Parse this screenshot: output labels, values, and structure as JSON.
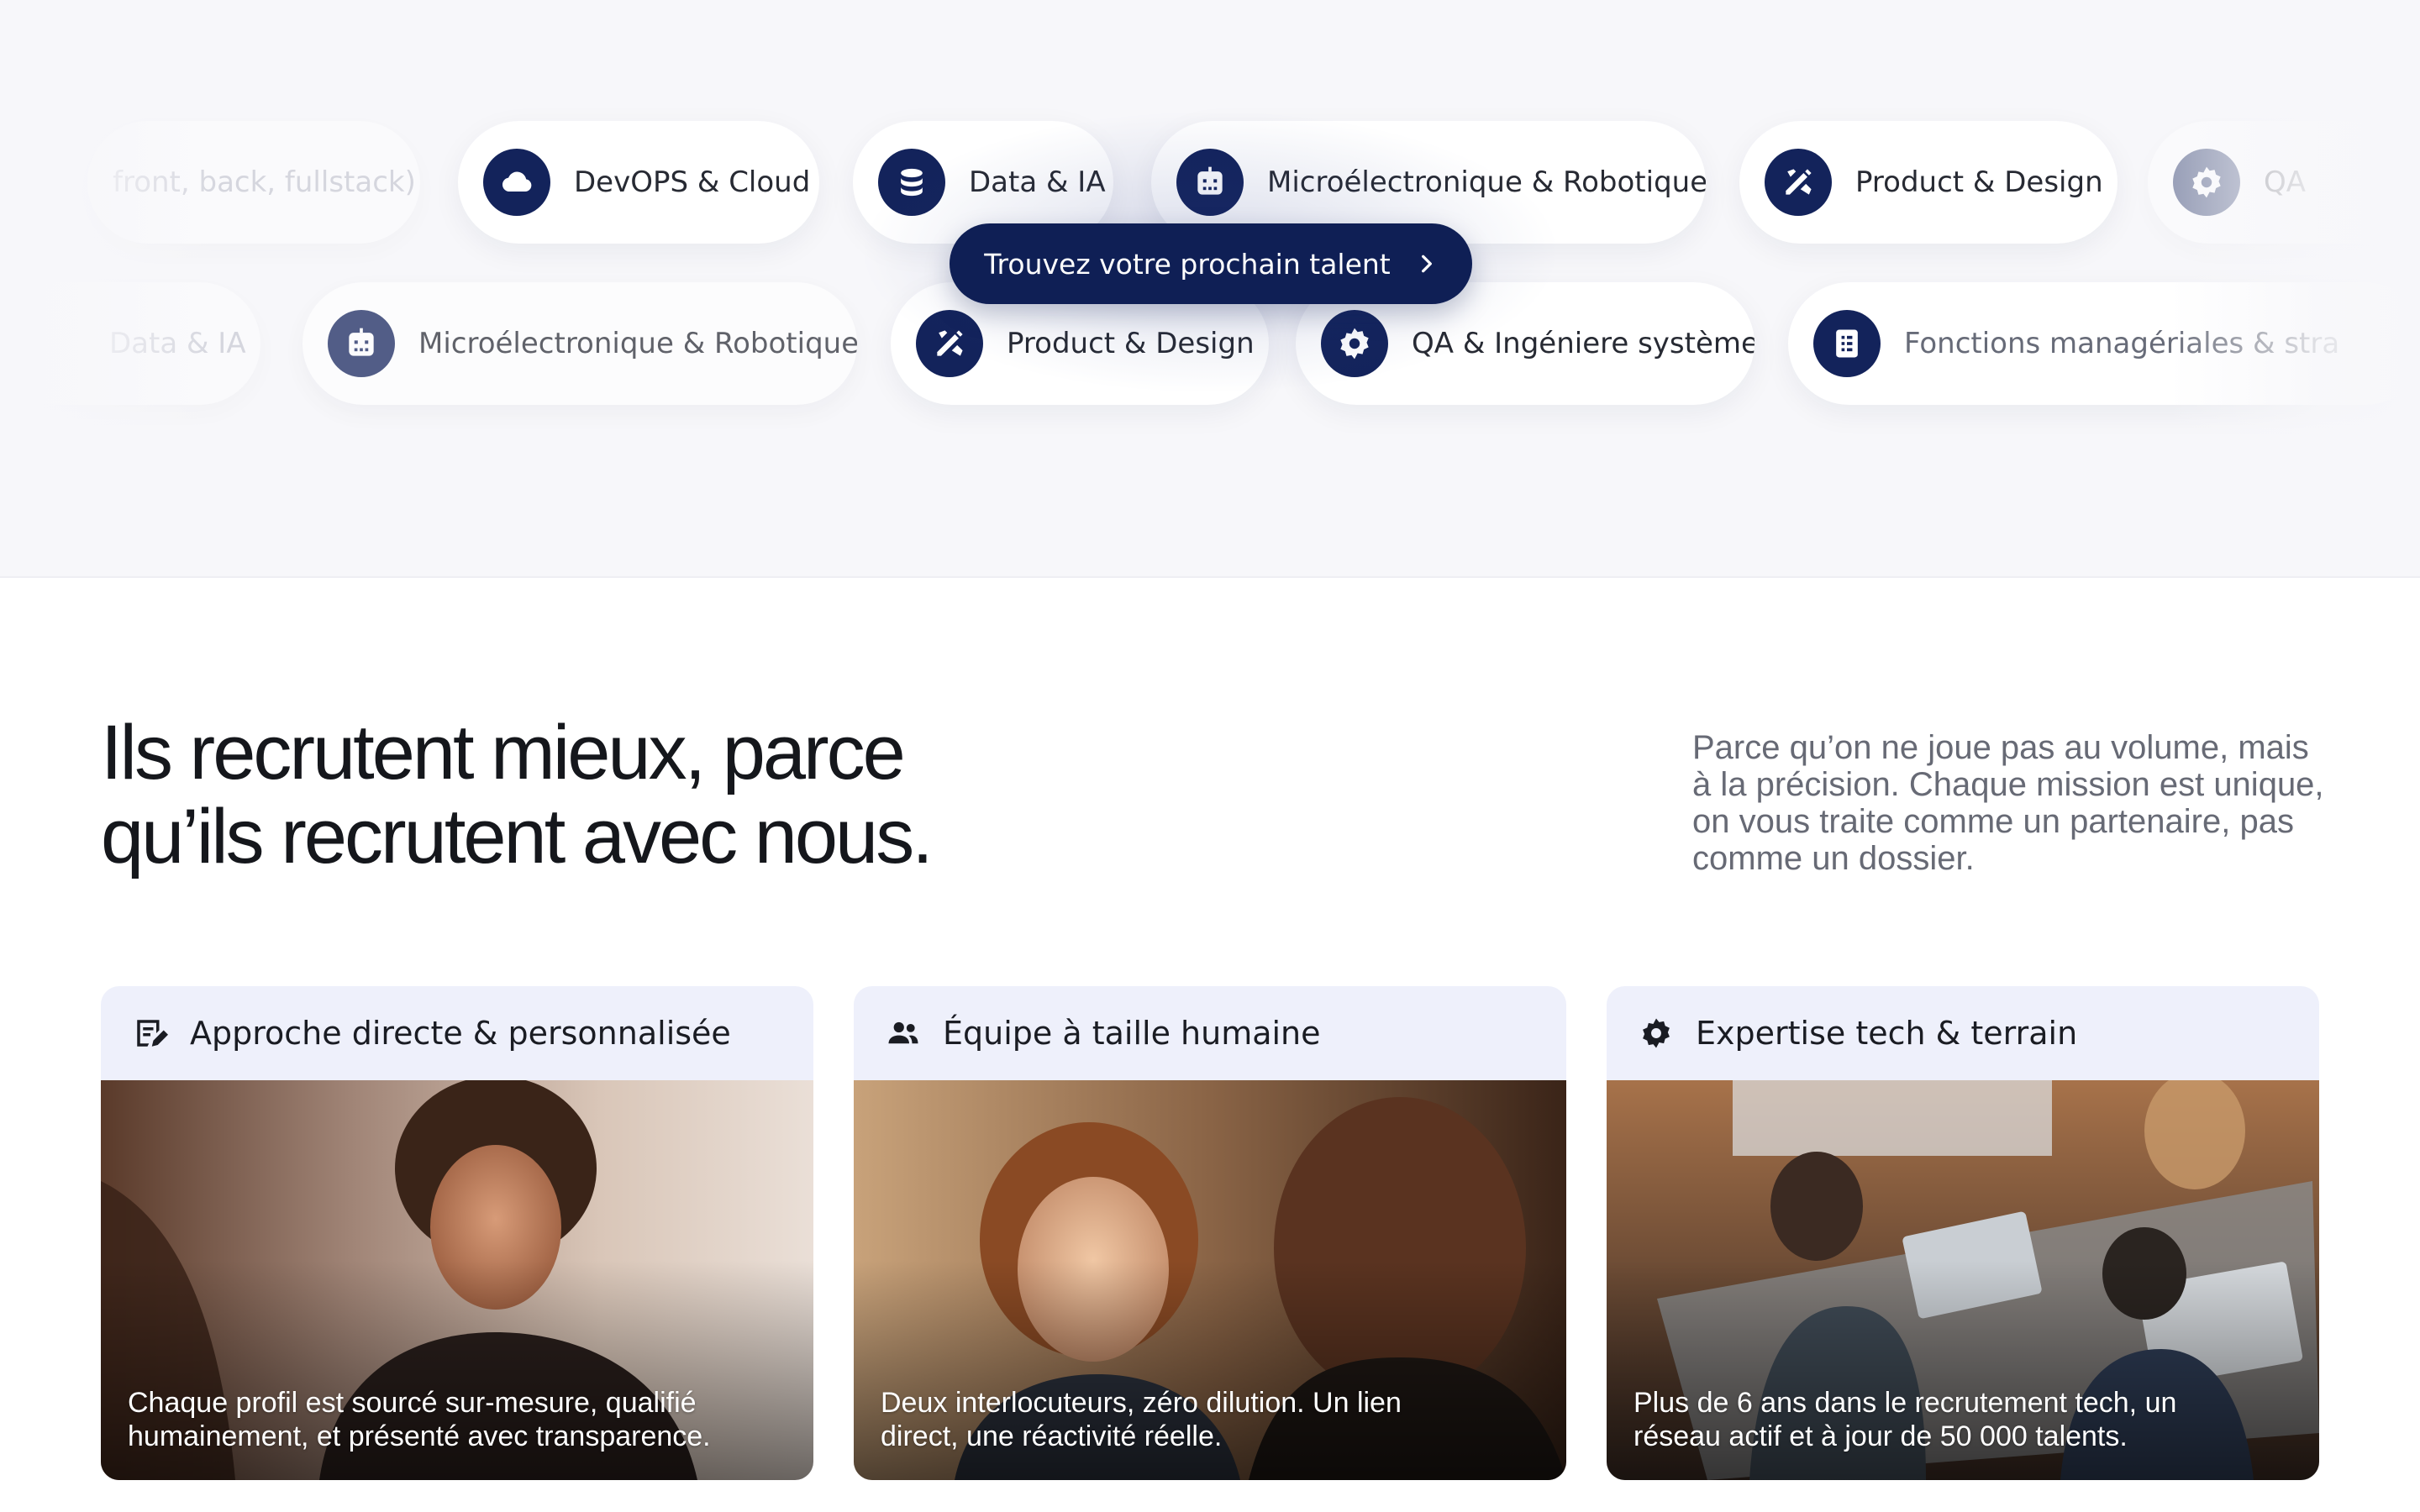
{
  "marquee": {
    "row1": [
      {
        "label": "front, back, fullstack)",
        "icon": "none"
      },
      {
        "label": "DevOPS & Cloud",
        "icon": "cloud-icon"
      },
      {
        "label": "Data & IA",
        "icon": "database-icon"
      },
      {
        "label": "Microélectronique & Robotique",
        "icon": "robot-icon"
      },
      {
        "label": "Product & Design",
        "icon": "design-tools-icon"
      },
      {
        "label": "QA",
        "icon": "gear-icon"
      }
    ],
    "row2": [
      {
        "label": "Data & IA",
        "icon": "none"
      },
      {
        "label": "Microélectronique & Robotique",
        "icon": "robot-icon"
      },
      {
        "label": "Product & Design",
        "icon": "design-tools-icon"
      },
      {
        "label": "QA & Ingéniere système",
        "icon": "gear-icon"
      },
      {
        "label": "Fonctions managériales & stra",
        "icon": "document-icon"
      }
    ]
  },
  "cta": {
    "label": "Trouvez votre prochain talent",
    "icon": "chevron-right-icon"
  },
  "section": {
    "headline_line1": "Ils recrutent mieux, parce",
    "headline_line2": "qu’ils recrutent avec nous.",
    "subtext": "Parce qu’on ne joue pas au volume, mais à la précision. Chaque mission est unique, on vous traite comme un partenaire, pas comme un dossier."
  },
  "cards": [
    {
      "title": "Approche directe & personnalisée",
      "icon": "edit-note-icon",
      "caption": "Chaque profil est sourcé sur-mesure, qualifié humainement, et présenté avec transparence."
    },
    {
      "title": "Équipe à taille humaine",
      "icon": "people-icon",
      "caption": "Deux interlocuteurs, zéro dilution. Un lien direct, une réactivité réelle."
    },
    {
      "title": "Expertise tech & terrain",
      "icon": "gear-icon",
      "caption": "Plus de 6 ans dans le recrutement tech, un réseau actif et à jour de 50 000 talents."
    }
  ],
  "colors": {
    "navy": "#0f1f55",
    "band": "#f7f7fa",
    "card_head": "#eef0fb"
  }
}
